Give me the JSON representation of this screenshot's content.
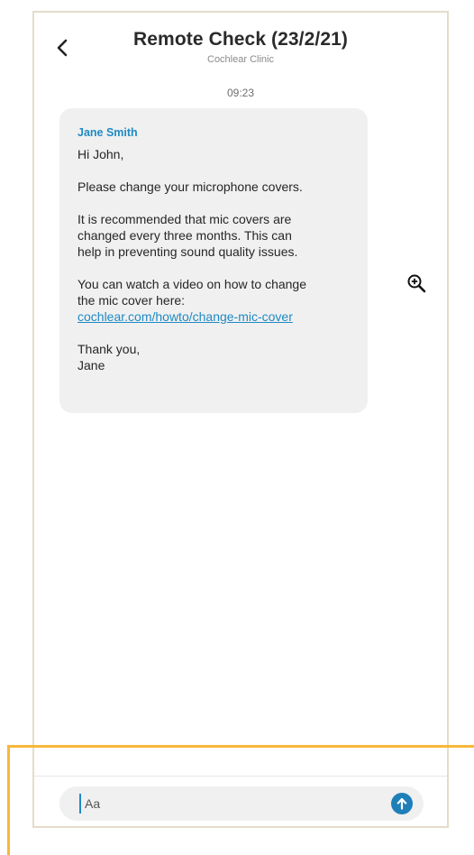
{
  "header": {
    "title": "Remote Check (23/2/21)",
    "subtitle": "Cochlear Clinic",
    "back_icon": "chevron-left-icon"
  },
  "conversation": {
    "timestamp": "09:23",
    "message": {
      "sender": "Jane Smith",
      "greeting": "Hi John,",
      "line1": "Please change your microphone covers.",
      "para2_l1": "It is recommended that mic covers are",
      "para2_l2": "changed every three months. This can",
      "para2_l3": "help in preventing sound quality issues.",
      "para3_l1": "You can watch a video on how to change",
      "para3_l2": "the mic cover here:",
      "link": "cochlear.com/howto/change-mic-cover",
      "closing": "Thank you,",
      "signature": "Jane"
    }
  },
  "zoom": {
    "icon": "zoom-in-icon"
  },
  "composer": {
    "placeholder": "Aa",
    "send_icon": "send-arrow-up-icon"
  },
  "colors": {
    "accent": "#1f8ac4",
    "bubble": "#f0f0f0",
    "highlight": "#f7b83a"
  }
}
